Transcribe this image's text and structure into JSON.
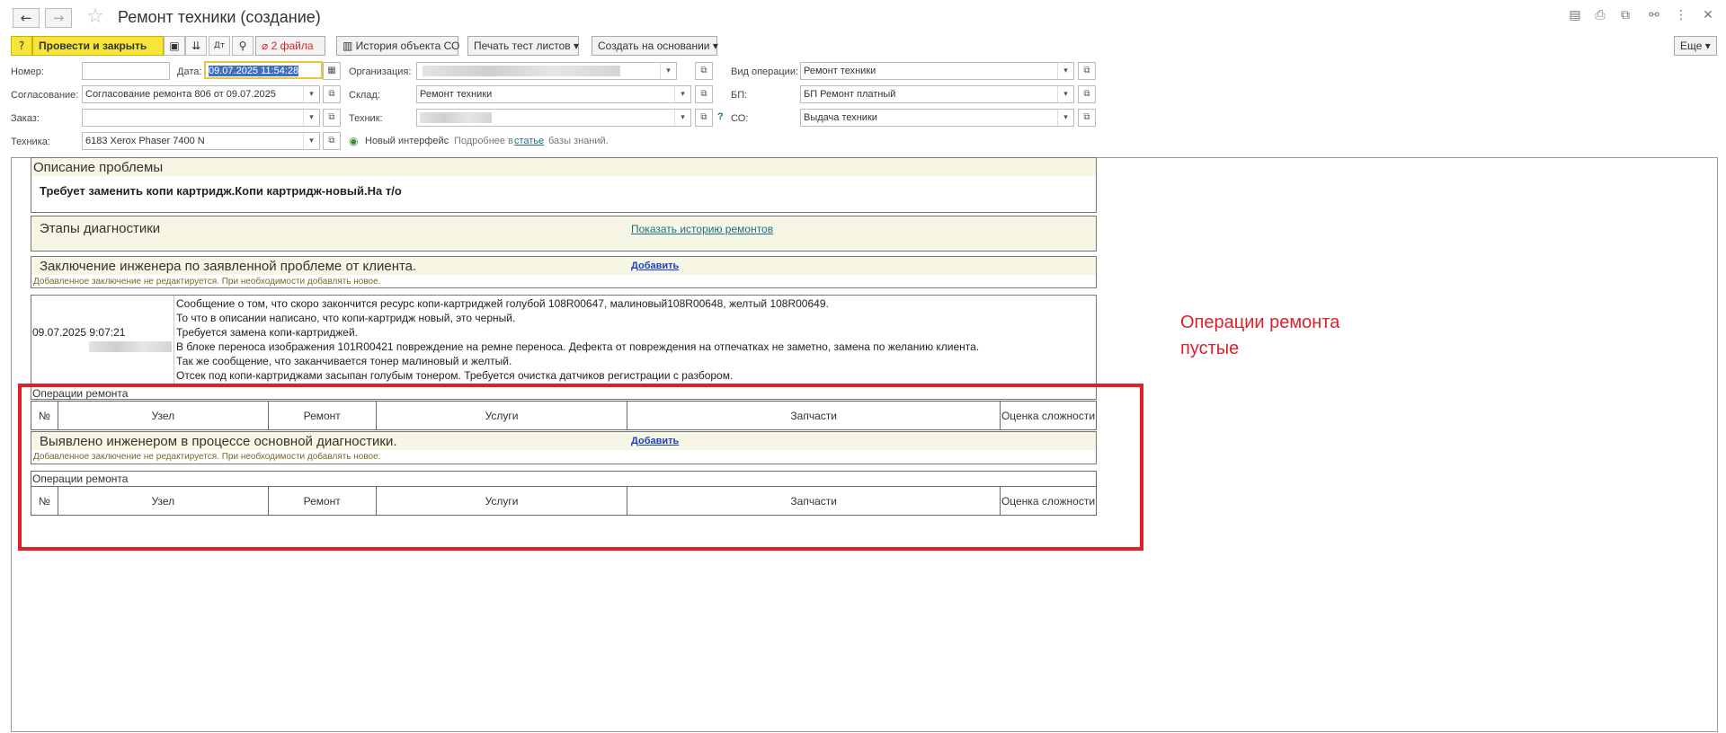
{
  "window": {
    "title": "Ремонт техники (создание)",
    "more_label": "Еще ▾"
  },
  "toolbar": {
    "post_close": "Провести и закрыть",
    "files": "2 файла",
    "history_co": "История объекта СО",
    "print_test": "Печать тест листов ▾",
    "create_based": "Создать на основании ▾"
  },
  "form": {
    "number_label": "Номер:",
    "number_value": "",
    "date_label": "Дата:",
    "date_value": "09.07.2025 11:54:28",
    "org_label": "Организация:",
    "op_type_label": "Вид операции:",
    "op_type_value": "Ремонт техники",
    "agreement_label": "Согласование:",
    "agreement_value": "Согласование ремонта 806 от 09.07.2025",
    "warehouse_label": "Склад:",
    "warehouse_value": "Ремонт техники",
    "bp_label": "БП:",
    "bp_value": "БП Ремонт платный",
    "order_label": "Заказ:",
    "order_value": "",
    "tech_label": "Техник:",
    "help_mark": "?",
    "co_label": "СО:",
    "co_value": "Выдача техники",
    "equipment_label": "Техника:",
    "equipment_value": "6183 Xerox Phaser 7400 N",
    "new_interface": "Новый интерфейс",
    "details_text": "Подробнее в",
    "article_link": "статье",
    "kb_text": "базы знаний."
  },
  "problem": {
    "title": "Описание проблемы",
    "text": "Требует заменить копи картридж.Копи картридж-новый.На т/о"
  },
  "diagnostics": {
    "title": "Этапы диагностики",
    "history_link": "Показать историю ремонтов"
  },
  "conclusion": {
    "title": "Заключение инженера по заявленной проблеме от клиента.",
    "add_link": "Добавить",
    "note": "Добавленное заключение не редактируется. При необходимости добавлять новое.",
    "date": "09.07.2025 9:07:21",
    "lines": [
      "Сообщение о том, что скоро закончится ресурс копи-картриджей голубой 108R00647, малиновый108R00648, желтый 108R00649.",
      "То что в описании написано, что копи-картридж новый, это черный.",
      "Требуется замена копи-картриджей.",
      "В блоке переноса изображения 101R00421 повреждение на ремне переноса. Дефекта от повреждения на отпечатках не заметно, замена по желанию клиента.",
      "Так же сообщение, что заканчивается тонер малиновый и желтый.",
      "Отсек под копи-картриджами засыпан голубым тонером. Требуется очистка датчиков регистрации с разбором."
    ]
  },
  "operations": {
    "label": "Операции ремонта",
    "columns": [
      "№",
      "Узел",
      "Ремонт",
      "Услуги",
      "Запчасти",
      "Оценка сложности"
    ]
  },
  "found": {
    "title": "Выявлено инженером в процессе основной диагностики.",
    "add_link": "Добавить",
    "note": "Добавленное заключение не редактируется. При необходимости добавлять новое."
  },
  "annotation": {
    "text": "Операции ремонта\nпустые",
    "color": "#e0202a"
  }
}
